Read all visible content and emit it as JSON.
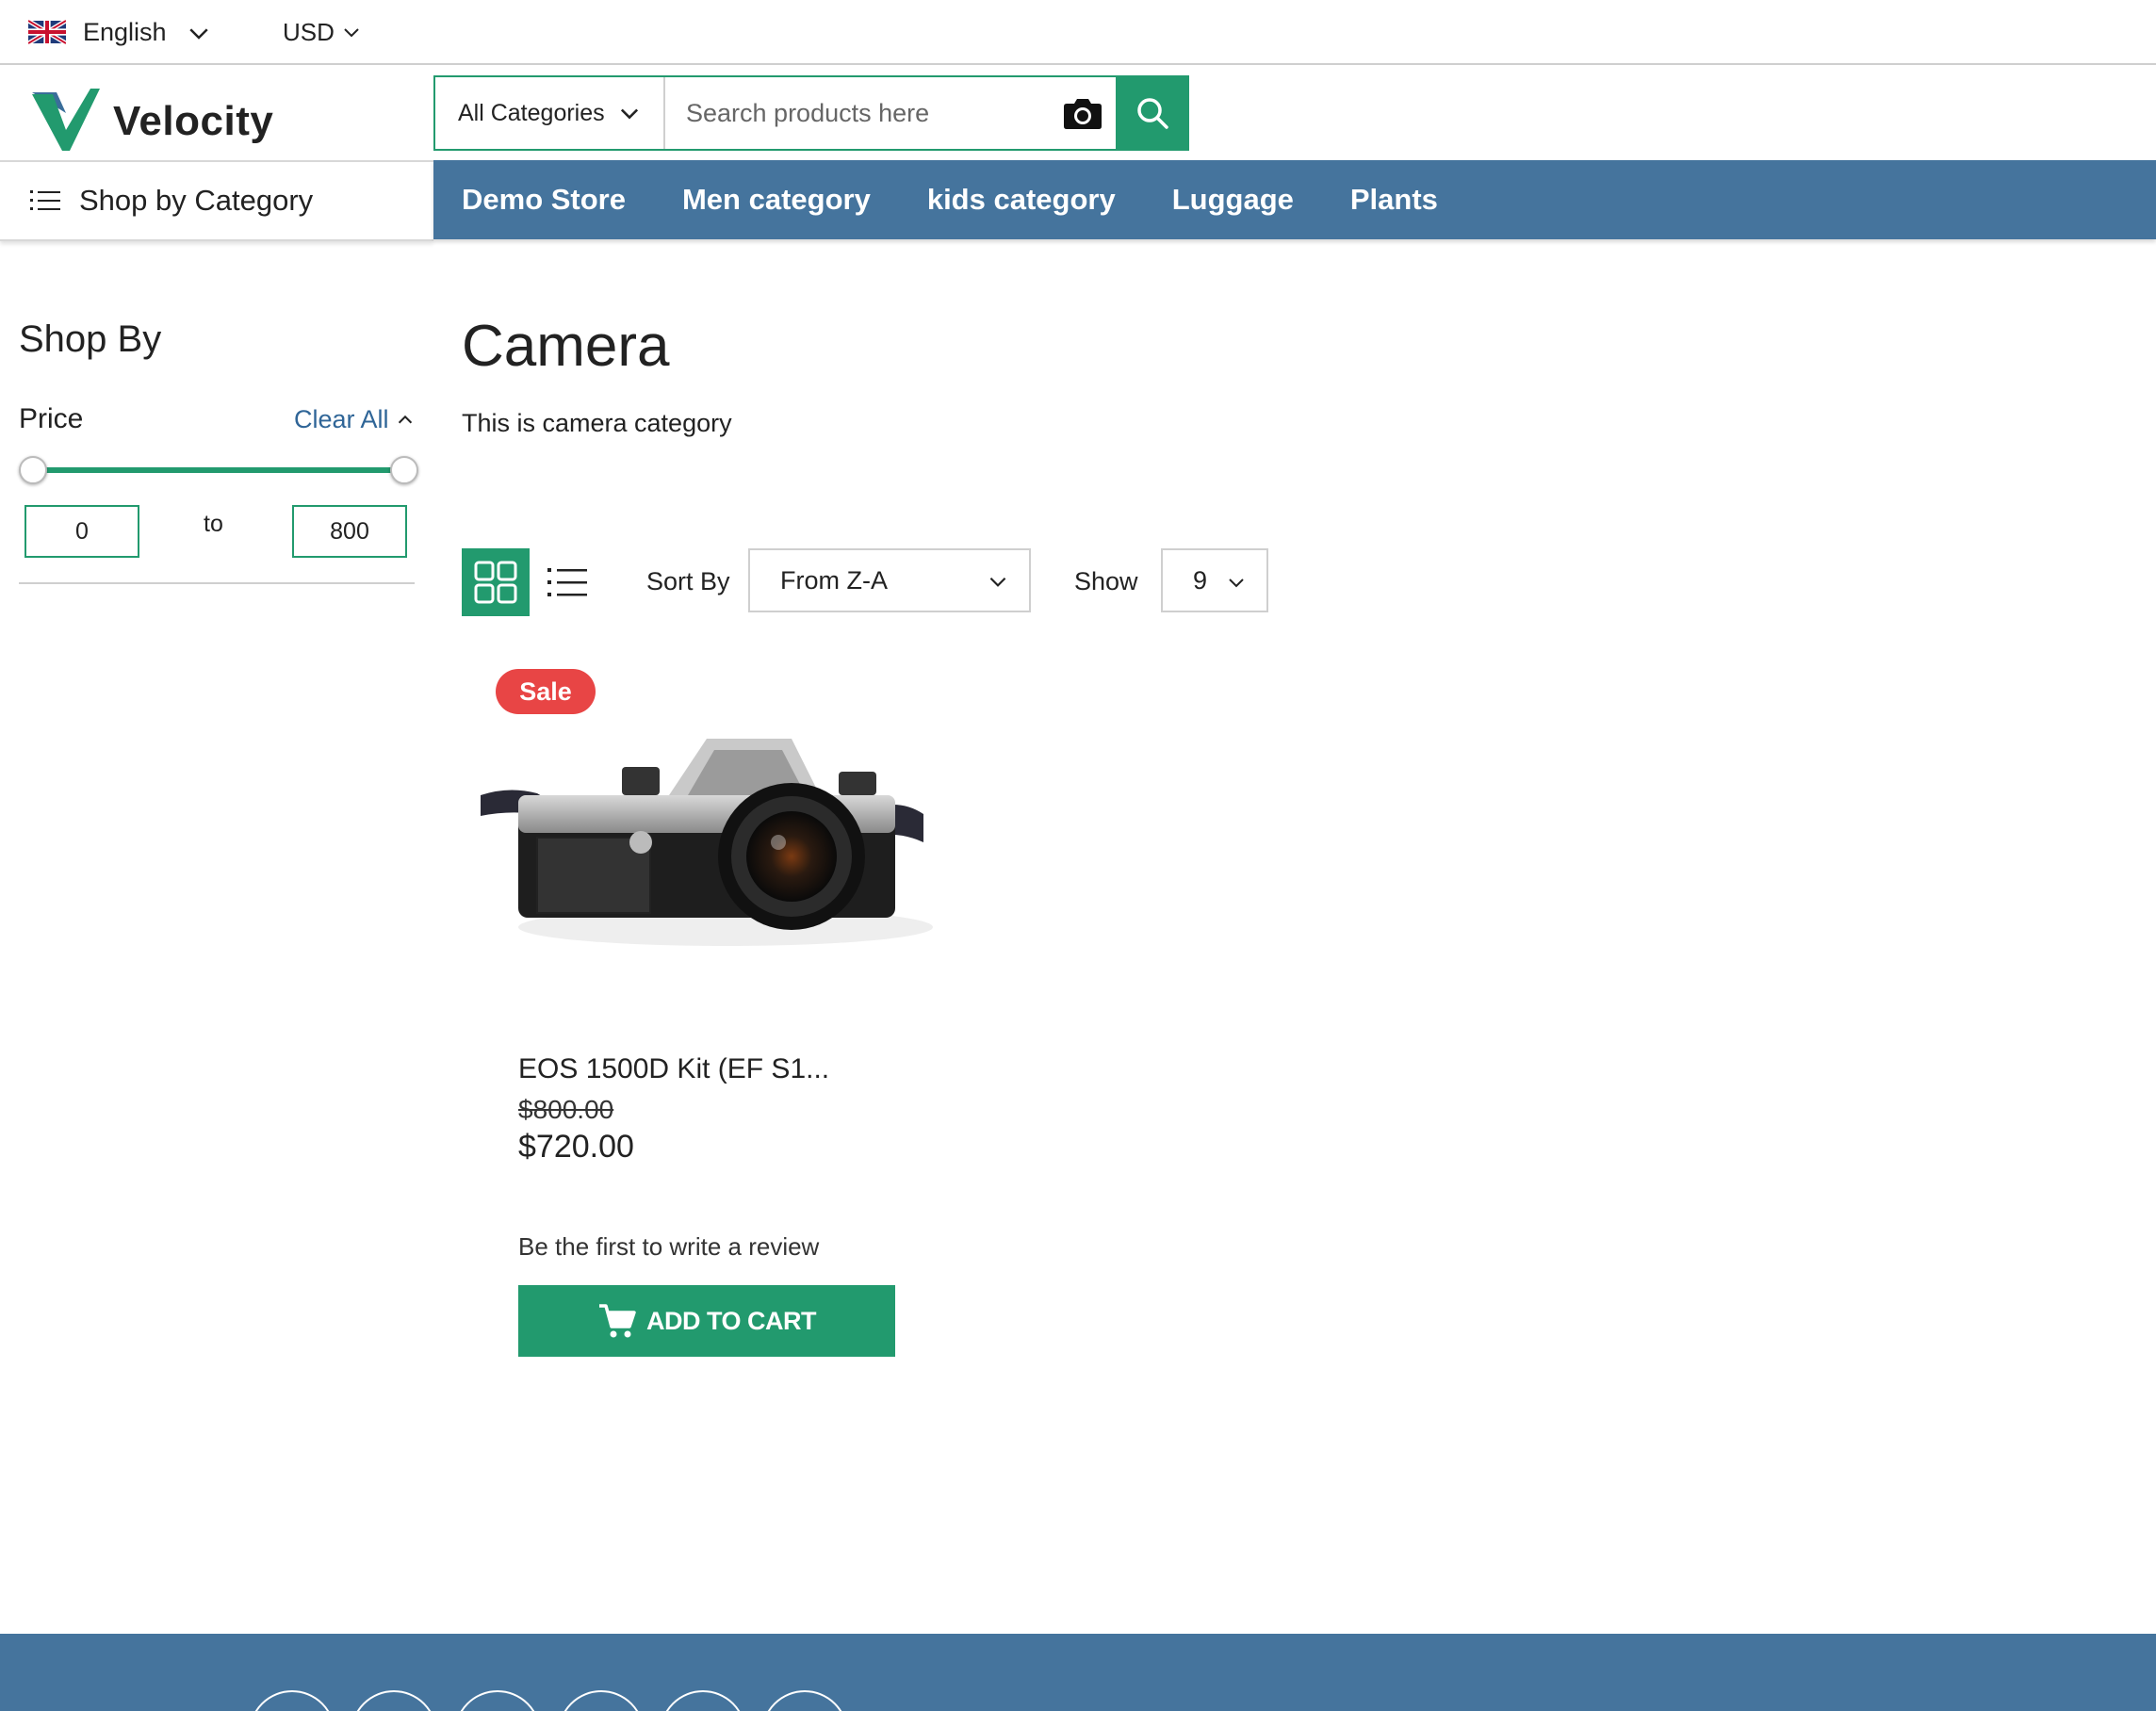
{
  "topbar": {
    "language": "English",
    "currency": "USD"
  },
  "header": {
    "brand": "Velocity",
    "search": {
      "category": "All Categories",
      "placeholder": "Search products here"
    }
  },
  "nav": {
    "shop_by_category": "Shop by Category",
    "items": [
      "Demo Store",
      "Men category",
      "kids category",
      "Luggage",
      "Plants"
    ]
  },
  "sidebar": {
    "title": "Shop By",
    "price_label": "Price",
    "clear_all": "Clear All",
    "min_value": "0",
    "to_label": "to",
    "max_value": "800"
  },
  "category": {
    "title": "Camera",
    "description": "This is camera category"
  },
  "toolbar": {
    "sort_label": "Sort By",
    "sort_value": "From Z-A",
    "show_label": "Show",
    "show_value": "9"
  },
  "product": {
    "badge": "Sale",
    "name": "EOS 1500D Kit (EF S1...",
    "old_price": "$800.00",
    "price": "$720.00",
    "review_text": "Be the first to write a review",
    "add_to_cart": "ADD TO CART"
  },
  "colors": {
    "primary_green": "#229a6e",
    "nav_blue": "#45749d",
    "sale_red": "#e84545",
    "link_blue": "#2f6597"
  },
  "icons": [
    "uk-flag-icon",
    "chevron-down-icon",
    "camera-icon",
    "search-icon",
    "menu-list-icon",
    "grid-view-icon",
    "list-view-icon",
    "shopping-cart-icon"
  ]
}
